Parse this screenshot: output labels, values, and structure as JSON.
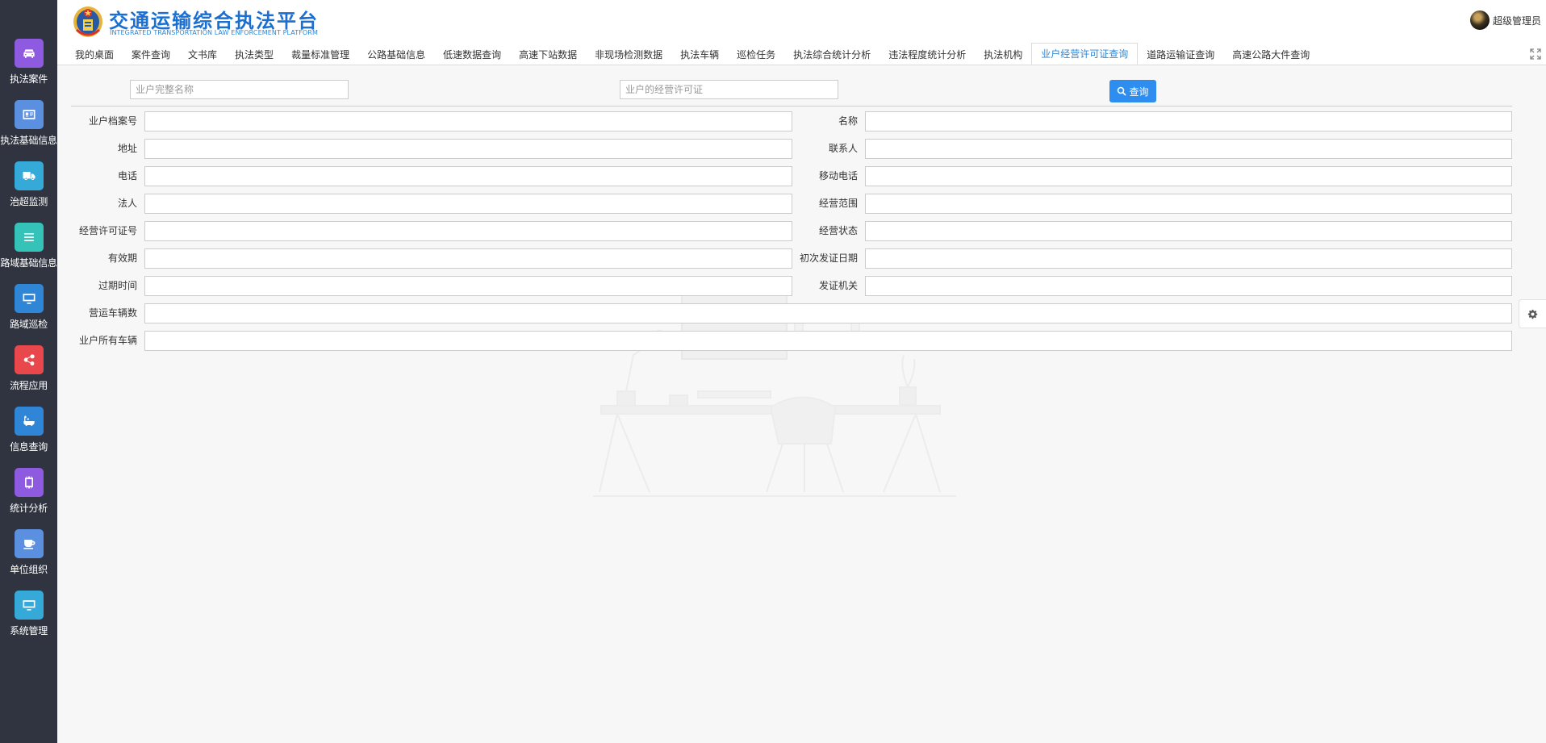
{
  "app": {
    "title": "交通运输综合执法平台",
    "subtitle": "INTEGRATED TRANSPORTATION LAW ENFORCEMENT PLATFORM"
  },
  "user": {
    "name": "超级管理员"
  },
  "sidebar": {
    "items": [
      {
        "label": "执法案件",
        "icon": "car-icon",
        "color": "#8e5ae0"
      },
      {
        "label": "执法基础信息",
        "icon": "id-card-icon",
        "color": "#5b8fe0"
      },
      {
        "label": "治超监测",
        "icon": "truck-icon",
        "color": "#35a9d8"
      },
      {
        "label": "路域基础信息",
        "icon": "list-icon",
        "color": "#35c2b8"
      },
      {
        "label": "路域巡检",
        "icon": "monitor-icon",
        "color": "#2f86d6"
      },
      {
        "label": "流程应用",
        "icon": "share-icon",
        "color": "#e8474b"
      },
      {
        "label": "信息查询",
        "icon": "bath-icon",
        "color": "#2f86d6"
      },
      {
        "label": "统计分析",
        "icon": "chip-icon",
        "color": "#8e5ae0"
      },
      {
        "label": "单位组织",
        "icon": "coffee-icon",
        "color": "#5b8fe0"
      },
      {
        "label": "系统管理",
        "icon": "desktop-icon",
        "color": "#35a9d8"
      }
    ]
  },
  "tabs": [
    {
      "label": "我的桌面",
      "active": false
    },
    {
      "label": "案件查询",
      "active": false
    },
    {
      "label": "文书库",
      "active": false
    },
    {
      "label": "执法类型",
      "active": false
    },
    {
      "label": "裁量标准管理",
      "active": false
    },
    {
      "label": "公路基础信息",
      "active": false
    },
    {
      "label": "低速数据查询",
      "active": false
    },
    {
      "label": "高速下站数据",
      "active": false
    },
    {
      "label": "非现场检测数据",
      "active": false
    },
    {
      "label": "执法车辆",
      "active": false
    },
    {
      "label": "巡检任务",
      "active": false
    },
    {
      "label": "执法综合统计分析",
      "active": false
    },
    {
      "label": "违法程度统计分析",
      "active": false
    },
    {
      "label": "执法机构",
      "active": false
    },
    {
      "label": "业户经营许可证查询",
      "active": true
    },
    {
      "label": "道路运输证查询",
      "active": false
    },
    {
      "label": "高速公路大件查询",
      "active": false
    }
  ],
  "search": {
    "name_placeholder": "业户完整名称",
    "license_placeholder": "业户的经营许可证",
    "query_label": "查询"
  },
  "form": {
    "archive_no": "业户档案号",
    "name": "名称",
    "address": "地址",
    "contact": "联系人",
    "phone": "电话",
    "mobile": "移动电话",
    "legal_person": "法人",
    "business_scope": "经营范围",
    "license_no": "经营许可证号",
    "business_status": "经营状态",
    "valid_period": "有效期",
    "first_issue_date": "初次发证日期",
    "expire_time": "过期时间",
    "issuing_authority": "发证机关",
    "vehicle_count": "营运车辆数",
    "owned_vehicles": "业户所有车辆"
  },
  "colors": {
    "accent": "#2d8ef0",
    "sidebar_bg": "#2f3440",
    "active_tab": "#2e87d8"
  }
}
